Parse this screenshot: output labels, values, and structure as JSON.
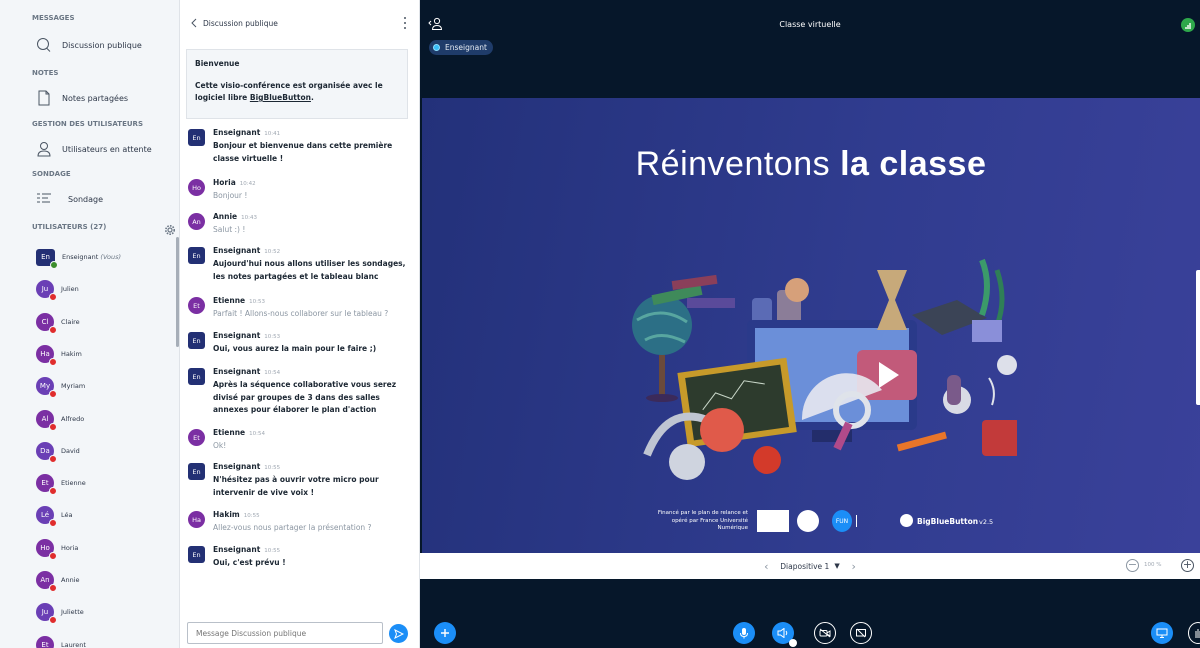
{
  "sidebar": {
    "messages_title": "MESSAGES",
    "public_chat": "Discussion publique",
    "notes_title": "NOTES",
    "shared_notes": "Notes partagées",
    "user_mgmt_title": "GESTION DES UTILISATEURS",
    "waiting_users": "Utilisateurs en attente",
    "poll_title": "SONDAGE",
    "poll": "Sondage",
    "users_title": "UTILISATEURS (27)",
    "users": [
      {
        "initials": "En",
        "name": "Enseignant",
        "suffix": "(Vous)",
        "color": "#233074"
      },
      {
        "initials": "Ju",
        "name": "Julien",
        "color": "#6a3fb5"
      },
      {
        "initials": "Cl",
        "name": "Claire",
        "color": "#7b2fa3"
      },
      {
        "initials": "Ha",
        "name": "Hakim",
        "color": "#7b2fa3"
      },
      {
        "initials": "My",
        "name": "Myriam",
        "color": "#6a3fb5"
      },
      {
        "initials": "Al",
        "name": "Alfredo",
        "color": "#7b2fa3"
      },
      {
        "initials": "Da",
        "name": "David",
        "color": "#6a3fb5"
      },
      {
        "initials": "Et",
        "name": "Etienne",
        "color": "#7b2fa3"
      },
      {
        "initials": "Lé",
        "name": "Léa",
        "color": "#6a3fb5"
      },
      {
        "initials": "Ho",
        "name": "Horia",
        "color": "#7b2fa3"
      },
      {
        "initials": "An",
        "name": "Annie",
        "color": "#7b2fa3"
      },
      {
        "initials": "Ju",
        "name": "Juliette",
        "color": "#6a3fb5"
      },
      {
        "initials": "Et",
        "name": "Laurent",
        "color": "#7b2fa3"
      }
    ]
  },
  "chat": {
    "title": "Discussion publique",
    "welcome_title": "Bienvenue",
    "welcome_text": "Cette visio-conférence est organisée avec le logiciel libre ",
    "welcome_link": "BigBlueButton",
    "welcome_end": ".",
    "messages": [
      {
        "initials": "En",
        "author": "Enseignant",
        "time": "10:41",
        "text": "Bonjour et bienvenue dans cette première classe virtuelle !",
        "teacher": true
      },
      {
        "initials": "Ho",
        "author": "Horia",
        "time": "10:42",
        "text": "Bonjour !",
        "color": "#7b2fa3"
      },
      {
        "initials": "An",
        "author": "Annie",
        "time": "10:43",
        "text": "Salut :) !",
        "color": "#7b2fa3"
      },
      {
        "initials": "En",
        "author": "Enseignant",
        "time": "10:52",
        "text": "Aujourd'hui nous allons utiliser les sondages, les notes partagées et le tableau blanc",
        "teacher": true
      },
      {
        "initials": "Et",
        "author": "Etienne",
        "time": "10:53",
        "text": "Parfait ! Allons-nous collaborer sur le tableau ?",
        "color": "#7b2fa3"
      },
      {
        "initials": "En",
        "author": "Enseignant",
        "time": "10:53",
        "text": "Oui, vous aurez la main pour le faire ;)",
        "teacher": true
      },
      {
        "initials": "En",
        "author": "Enseignant",
        "time": "10:54",
        "text": "Après la séquence collaborative vous serez divisé par groupes de 3 dans des salles annexes pour élaborer le plan d'action",
        "teacher": true
      },
      {
        "initials": "Et",
        "author": "Etienne",
        "time": "10:54",
        "text": "Ok!",
        "color": "#7b2fa3"
      },
      {
        "initials": "En",
        "author": "Enseignant",
        "time": "10:55",
        "text": "N'hésitez pas à ouvrir votre micro pour intervenir de vive voix !",
        "teacher": true
      },
      {
        "initials": "Ha",
        "author": "Hakim",
        "time": "10:55",
        "text": "Allez-vous nous partager la présentation ?",
        "color": "#7b2fa3"
      },
      {
        "initials": "En",
        "author": "Enseignant",
        "time": "10:55",
        "text": "Oui, c'est prévu !",
        "teacher": true
      }
    ],
    "input_placeholder": "Message Discussion publique"
  },
  "main": {
    "title": "Classe virtuelle",
    "role": "Enseignant",
    "slide": {
      "title_light": "Réinventons ",
      "title_bold": "la classe",
      "footer": "Financé par le plan de relance et opéré par France Université Numérique",
      "bbb": "BigBlueButton",
      "version": "v2.5",
      "fun": "FUN"
    },
    "slide_label": "Diapositive 1",
    "zoom": "100 %"
  },
  "colors": {
    "accent": "#1b8ef7",
    "teacher": "#233074",
    "student": "#7b2fa3",
    "muted": "#e02d2d",
    "slide_bg": "#2c3888"
  }
}
